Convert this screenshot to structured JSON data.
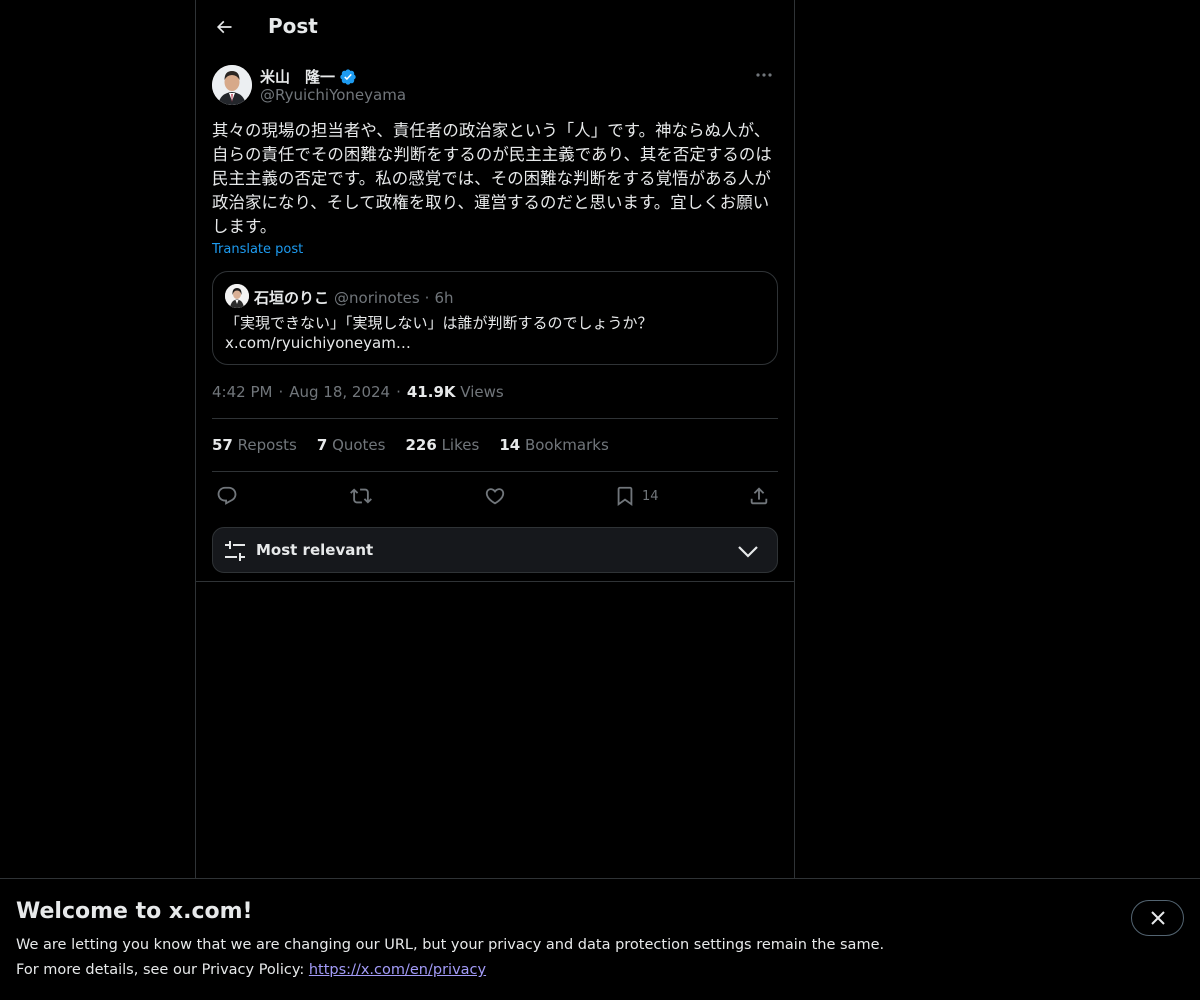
{
  "header": {
    "title": "Post"
  },
  "post": {
    "author_name": "米山　隆一",
    "author_handle": "@RyuichiYoneyama",
    "verified": true,
    "text": "其々の現場の担当者や、責任者の政治家という「人」です。神ならぬ人が、自らの責任でその困難な判断をするのが民主主義であり、其を否定するのは民主主義の否定です。私の感覚では、その困難な判断をする覚悟がある人が政治家になり、そして政権を取り、運営するのだと思います。宜しくお願いします。",
    "translate_label": "Translate post",
    "time": "4:42 PM",
    "date": "Aug 18, 2024",
    "views_count": "41.9K",
    "views_label": "Views",
    "sep": "·"
  },
  "quote": {
    "name": "石垣のりこ",
    "handle": "@norinotes",
    "sep": "·",
    "time": "6h",
    "text_line1": "「実現できない」「実現しない」は誰が判断するのでしょうか？",
    "text_line2": "x.com/ryuichiyoneyam…"
  },
  "stats": {
    "reposts_count": "57",
    "reposts_label": "Reposts",
    "quotes_count": "7",
    "quotes_label": "Quotes",
    "likes_count": "226",
    "likes_label": "Likes",
    "bookmarks_count": "14",
    "bookmarks_label": "Bookmarks"
  },
  "actions": {
    "bookmark_count": "14",
    "icons": [
      "reply-icon",
      "repost-icon",
      "like-icon",
      "bookmark-icon",
      "share-icon"
    ]
  },
  "sort": {
    "label": "Most relevant"
  },
  "banner": {
    "title": "Welcome to x.com!",
    "line1": "We are letting you know that we are changing our URL, but your privacy and data protection settings remain the same.",
    "line2_prefix": "For more details, see our Privacy Policy: ",
    "line2_link": "https://x.com/en/privacy"
  },
  "colors": {
    "background": "#000000",
    "text": "#e7e9ea",
    "muted": "#71767b",
    "accent": "#1d9bf0",
    "border": "#2f3336",
    "link": "#a29bf7"
  }
}
